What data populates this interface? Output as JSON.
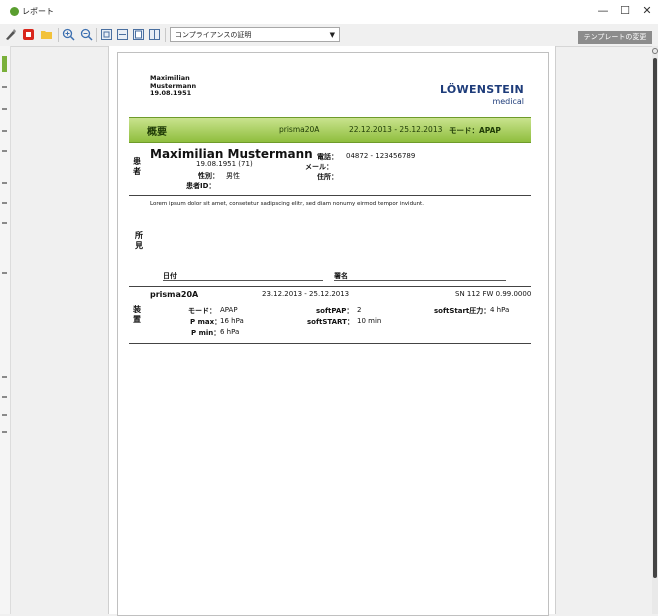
{
  "window": {
    "title": "レポート",
    "controls": [
      "—",
      "☐",
      "✕"
    ]
  },
  "toolbar": {
    "select_value": "コンプライアンスの証明",
    "template_button": "テンプレートの変更"
  },
  "report": {
    "header": {
      "first_name": "Maximilian",
      "last_name": "Mustermann",
      "birthdate": "19.08.1951",
      "logo_main": "LÖWENSTEIN",
      "logo_sub": "medical"
    },
    "banner": {
      "title": "概要",
      "device": "prisma20A",
      "period": "22.12.2013 - 25.12.2013",
      "mode": "モード：APAP"
    },
    "patient": {
      "side_label": "患者",
      "full_name": "Maximilian Mustermann",
      "dob_age": "19.08.1951 (71)",
      "sex_label": "性別：",
      "sex_value": "男性",
      "id_label": "患者ID：",
      "phone_label": "電話：",
      "phone_value": "04872 - 123456789",
      "mail_label": "メール：",
      "address_label": "住所："
    },
    "findings": {
      "side_label": "所見",
      "text": "Lorem ipsum dolor sit amet, consetetur sadipscing elitr, sed diam nonumy eirmod tempor invidunt.",
      "date_label": "日付",
      "signature_label": "署名"
    },
    "device": {
      "side_label": "装置",
      "name": "prisma20A",
      "period": "23.12.2013 - 25.12.2013",
      "serial": "SN 112 FW 0.99.0000",
      "mode_label": "モード：",
      "mode_value": "APAP",
      "pmax_label": "P max：",
      "pmax_value": "16 hPa",
      "pmin_label": "P min：",
      "pmin_value": "6 hPa",
      "softpap_label": "softPAP：",
      "softpap_value": "2",
      "softstart_label": "softSTART：",
      "softstart_value": "10 min",
      "softstart_pressure_label": "softStart圧力：",
      "softstart_pressure_value": "4 hPa"
    }
  }
}
